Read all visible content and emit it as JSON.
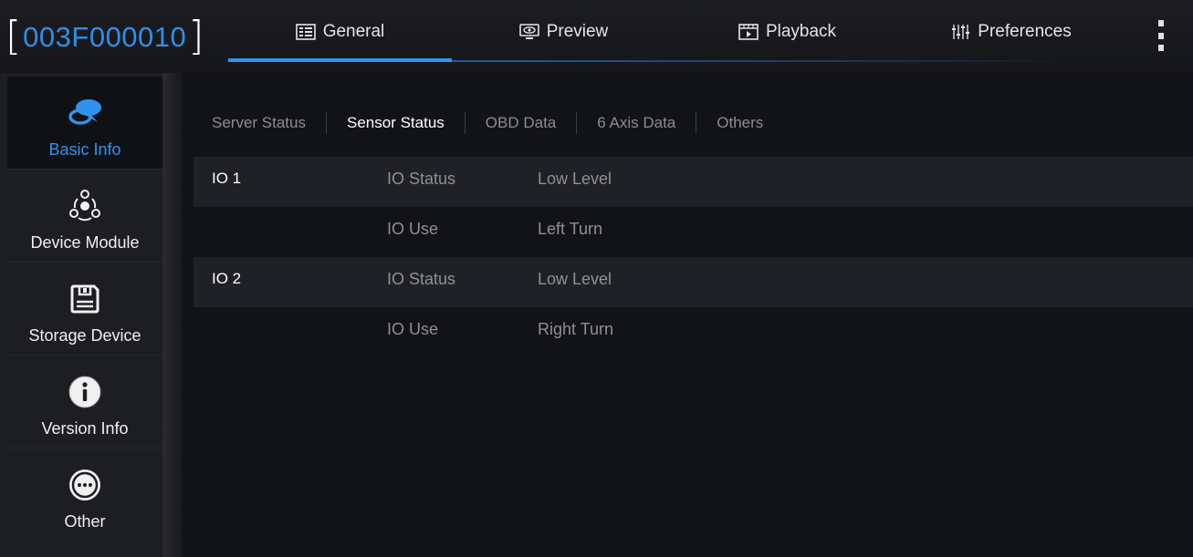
{
  "header": {
    "device_id": "003F000010",
    "tabs": [
      {
        "label": "General",
        "icon": "general-grid-icon"
      },
      {
        "label": "Preview",
        "icon": "monitor-eye-icon"
      },
      {
        "label": "Playback",
        "icon": "film-play-icon"
      },
      {
        "label": "Preferences",
        "icon": "sliders-icon"
      }
    ],
    "active_tab": "General",
    "accent_color": "#2f93ee"
  },
  "sidebar": {
    "items": [
      {
        "label": "Basic Info",
        "icon": "chat-bubble-icon",
        "active": true
      },
      {
        "label": "Device Module",
        "icon": "module-nodes-icon"
      },
      {
        "label": "Storage Device",
        "icon": "floppy-disk-icon"
      },
      {
        "label": "Version Info",
        "icon": "info-circle-icon"
      },
      {
        "label": "Other",
        "icon": "more-circle-icon"
      }
    ]
  },
  "subtabs": {
    "items": [
      "Server Status",
      "Sensor Status",
      "OBD Data",
      "6 Axis Data",
      "Others"
    ],
    "active": "Sensor Status"
  },
  "sensor_table": {
    "rows": [
      {
        "channel": "IO 1",
        "field": "IO Status",
        "value": "Low Level"
      },
      {
        "channel": "",
        "field": "IO Use",
        "value": "Left Turn"
      },
      {
        "channel": "IO 2",
        "field": "IO Status",
        "value": "Low Level"
      },
      {
        "channel": "",
        "field": "IO Use",
        "value": "Right Turn"
      }
    ]
  }
}
